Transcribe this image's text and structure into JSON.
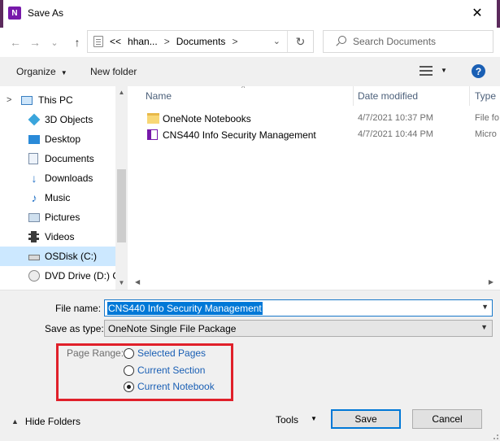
{
  "window": {
    "title": "Save As",
    "app_icon_letter": "N",
    "close_glyph": "✕"
  },
  "address": {
    "back_glyph": "←",
    "forward_glyph": "→",
    "down_glyph": "⌄",
    "up_glyph": "↑",
    "crumbs": [
      "<<",
      "hhan...",
      "Documents"
    ],
    "separator": ">",
    "dropdown_glyph": "⌄",
    "refresh_glyph": "↻"
  },
  "search": {
    "placeholder": "Search Documents"
  },
  "toolbar": {
    "organize_label": "Organize",
    "new_folder_label": "New folder",
    "help_glyph": "?"
  },
  "nav": {
    "items": [
      {
        "label": "This PC",
        "icon": "monitor-icon",
        "chevron": ">",
        "selected": false
      },
      {
        "label": "3D Objects",
        "icon": "cube-icon",
        "selected": false
      },
      {
        "label": "Desktop",
        "icon": "desktop-icon",
        "selected": false
      },
      {
        "label": "Documents",
        "icon": "documents-icon",
        "selected": false
      },
      {
        "label": "Downloads",
        "icon": "download-arrow-icon",
        "selected": false
      },
      {
        "label": "Music",
        "icon": "music-note-icon",
        "selected": false
      },
      {
        "label": "Pictures",
        "icon": "pictures-icon",
        "selected": false
      },
      {
        "label": "Videos",
        "icon": "film-icon",
        "selected": false
      },
      {
        "label": "OSDisk (C:)",
        "icon": "drive-icon",
        "selected": true
      },
      {
        "label": "DVD Drive (D:) C",
        "icon": "disc-icon",
        "selected": false
      }
    ]
  },
  "files": {
    "columns": {
      "name": "Name",
      "date": "Date modified",
      "type": "Type"
    },
    "rows": [
      {
        "name": "OneNote Notebooks",
        "date": "4/7/2021 10:37 PM",
        "type": "File fo",
        "icon": "folder-icon"
      },
      {
        "name": "CNS440 Info Security Management",
        "date": "4/7/2021 10:44 PM",
        "type": "Micro",
        "icon": "onenote-file-icon"
      }
    ]
  },
  "form": {
    "file_name_label": "File name:",
    "file_name_value": "CNS440 Info Security Management",
    "save_type_label": "Save as type:",
    "save_type_value": "OneNote Single File Package"
  },
  "page_range": {
    "label": "Page Range:",
    "options": [
      {
        "label": "Selected Pages",
        "checked": false
      },
      {
        "label": "Current Section",
        "checked": false
      },
      {
        "label": "Current Notebook",
        "checked": true
      }
    ]
  },
  "footer": {
    "hide_folders_label": "Hide Folders",
    "tools_label": "Tools",
    "save_label": "Save",
    "cancel_label": "Cancel"
  },
  "colors": {
    "frame": "#5b2a5c",
    "accent": "#0078d7",
    "highlight_box": "#e0202a",
    "selected_nav": "#cce8ff"
  }
}
